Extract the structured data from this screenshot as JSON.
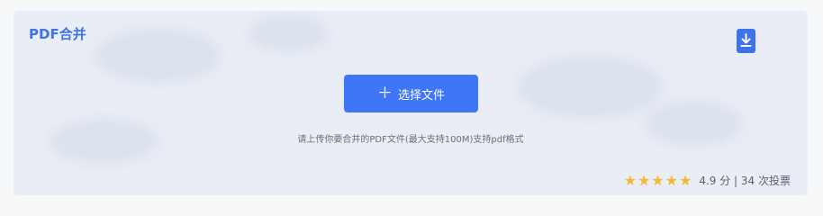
{
  "card": {
    "title": "PDF合并"
  },
  "select_button": {
    "label": "选择文件"
  },
  "hint": "请上传你要合并的PDF文件(最大支持100M)支持pdf格式",
  "rating": {
    "stars": 5,
    "text": "4.9 分 | 34 次投票"
  },
  "icons": {
    "download": "download-icon",
    "plus": "plus-icon",
    "star": "star-icon"
  },
  "colors": {
    "accent": "#3f73ea",
    "star": "#f7b731",
    "card_background": "#e9edf5"
  }
}
